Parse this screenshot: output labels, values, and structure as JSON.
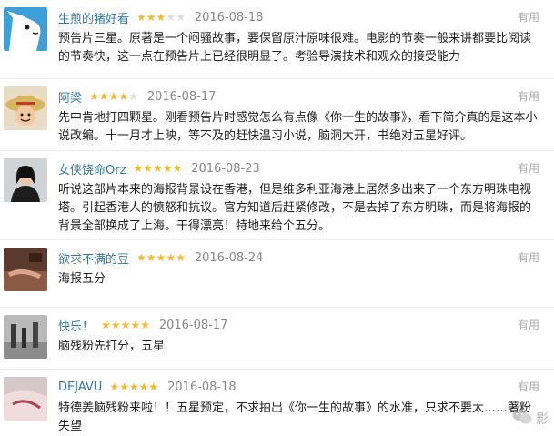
{
  "reviews": [
    {
      "user": "生煎的猪好看",
      "rating": 3,
      "date": "2016-08-18",
      "useful": "有用",
      "text": "预告片三星。原著是一个闷骚故事，要保留原汁原味很难。电影的节奏一般来讲都要比阅读的节奏快，这一点在预告片上已经很明显了。考验导演技术和观众的接受能力"
    },
    {
      "user": "阿梁",
      "rating": 4,
      "date": "2016-08-17",
      "useful": "有用",
      "text": "先中肯地打四颗星。刚看预告片时感觉怎么有点像《你一生的故事》，看下简介真的是这本小说改编。十一月才上映，等不及的赶快温习小说，脑洞大开，书绝对五星好评。"
    },
    {
      "user": "女侠饶命Orz",
      "rating": 5,
      "date": "2016-08-23",
      "useful": "有用",
      "text": "听说这部片本来的海报背景设在香港，但是维多利亚海港上居然多出来了一个东方明珠电视塔。引起香港人的愤怒和抗议。官方知道后赶紧修改，不是去掉了东方明珠，而是将海报的背景全部换成了上海。干得漂亮！特地来给个五分。"
    },
    {
      "user": "欲求不满的豆",
      "rating": 5,
      "date": "2016-08-24",
      "useful": "有用",
      "text": "海报五分"
    },
    {
      "user": "快乐！",
      "rating": 5,
      "date": "2016-08-17",
      "useful": "有用",
      "text": "脑残粉先打分，五星"
    },
    {
      "user": "DEJAVU",
      "rating": 5,
      "date": "2016-08-18",
      "useful": "有用",
      "text": "特德姜脑残粉来啦！！五星预定，不求拍出《你一生的故事》的水准，只求不要太……著粉失望"
    }
  ],
  "watermark": {
    "icon": "wechat-icon",
    "text": "影"
  },
  "colors": {
    "username": "#3377aa",
    "star_on": "#f5b82e",
    "star_off": "#dcdcdc",
    "date": "#888888"
  }
}
